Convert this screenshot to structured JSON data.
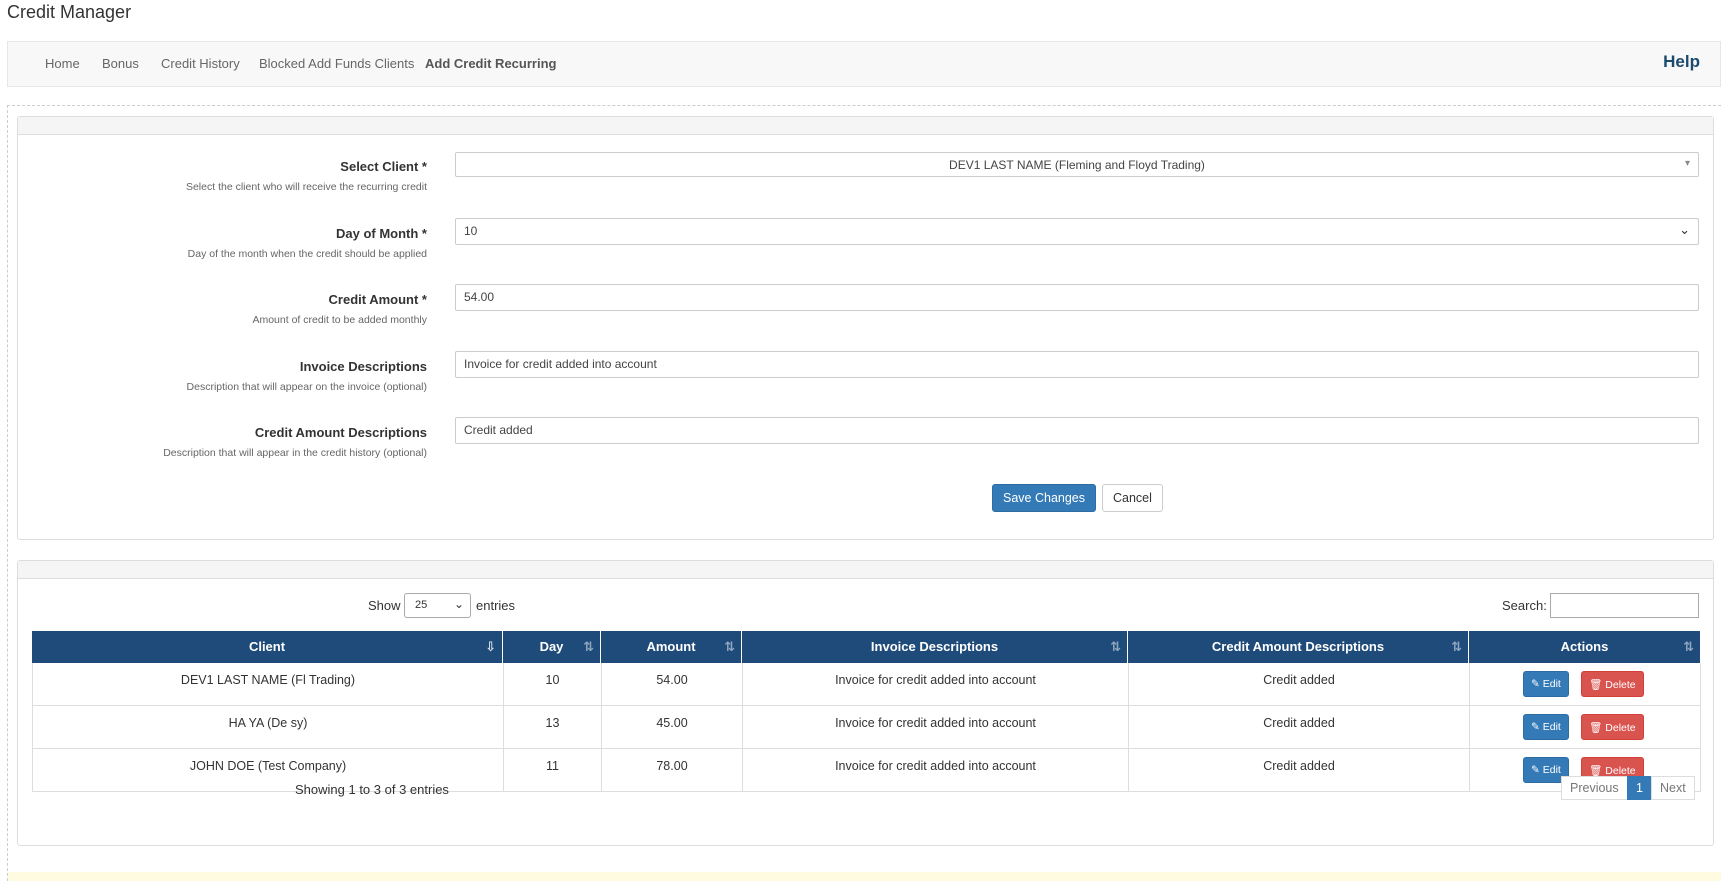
{
  "page": {
    "title": "Credit Manager"
  },
  "nav": {
    "items": [
      {
        "label": "Home"
      },
      {
        "label": "Bonus"
      },
      {
        "label": "Credit History"
      },
      {
        "label": "Blocked Add Funds Clients"
      },
      {
        "label": "Add Credit Recurring"
      }
    ],
    "help": "Help"
  },
  "form": {
    "client": {
      "label": "Select Client *",
      "help": "Select the client who will receive the recurring credit",
      "value": "DEV1 LAST NAME (Fleming and Floyd Trading)"
    },
    "day": {
      "label": "Day of Month *",
      "help": "Day of the month when the credit should be applied",
      "value": "10"
    },
    "amount": {
      "label": "Credit Amount *",
      "help": "Amount of credit to be added monthly",
      "value": "54.00"
    },
    "invoice": {
      "label": "Invoice Descriptions",
      "help": "Description that will appear on the invoice (optional)",
      "value": "Invoice for credit added into account"
    },
    "credit_desc": {
      "label": "Credit Amount Descriptions",
      "help": "Description that will appear in the credit history (optional)",
      "value": "Credit added"
    },
    "save": "Save Changes",
    "cancel": "Cancel"
  },
  "table": {
    "show": "Show",
    "length": "25",
    "entries": "entries",
    "search": "Search:",
    "columns": [
      "Client",
      "Day",
      "Amount",
      "Invoice Descriptions",
      "Credit Amount Descriptions",
      "Actions"
    ],
    "rows": [
      {
        "client": "DEV1 LAST NAME (Fl                              Trading)",
        "day": "10",
        "amount": "54.00",
        "invoice": "Invoice for credit added into account",
        "credit": "Credit added"
      },
      {
        "client": "HA        YA       (De       sy)",
        "day": "13",
        "amount": "45.00",
        "invoice": "Invoice for credit added into account",
        "credit": "Credit added"
      },
      {
        "client": "JOHN DOE (Test Company)",
        "day": "11",
        "amount": "78.00",
        "invoice": "Invoice for credit added into account",
        "credit": "Credit added"
      }
    ],
    "edit": "Edit",
    "delete": "Delete",
    "info": "Showing 1 to 3 of 3 entries",
    "previous": "Previous",
    "page": "1",
    "next": "Next"
  },
  "colors": {
    "primary": "#337ab7",
    "danger": "#d9534f",
    "header": "#1f4b7a",
    "help": "#1a4a6e"
  },
  "icons": {
    "sort": "sort-icon",
    "edit": "edit-icon",
    "delete": "trash-icon",
    "dropdown": "chevron-down-icon"
  }
}
